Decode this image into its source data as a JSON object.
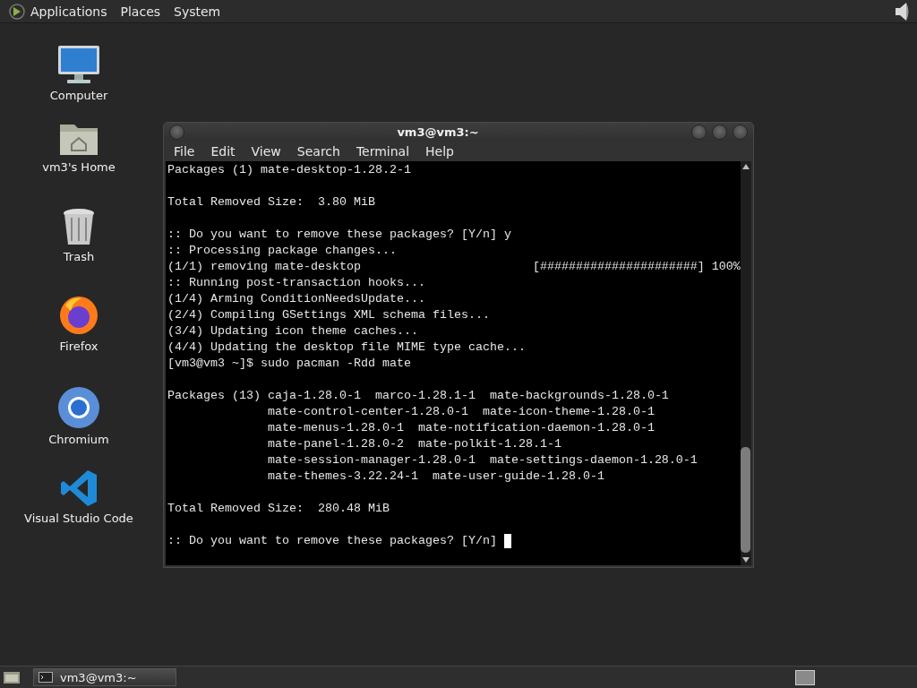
{
  "top_panel": {
    "menus": [
      "Applications",
      "Places",
      "System"
    ]
  },
  "desktop_icons": [
    {
      "label": "Computer",
      "kind": "computer"
    },
    {
      "label": "vm3's Home",
      "kind": "home"
    },
    {
      "label": "Trash",
      "kind": "trash"
    },
    {
      "label": "Firefox",
      "kind": "firefox"
    },
    {
      "label": "Chromium",
      "kind": "chromium"
    },
    {
      "label": "Visual Studio Code",
      "kind": "vscode"
    }
  ],
  "window": {
    "title": "vm3@vm3:~",
    "menu": [
      "File",
      "Edit",
      "View",
      "Search",
      "Terminal",
      "Help"
    ],
    "terminal_blocks": [
      {
        "lines": [
          {
            "text": "Packages (1) mate-desktop-1.28.2-1"
          }
        ]
      },
      {
        "lines": [
          {
            "text": "Total Removed Size:  3.80 MiB"
          }
        ]
      },
      {
        "lines": [
          {
            "text": ":: Do you want to remove these packages? [Y/n] y"
          },
          {
            "text": ":: Processing package changes..."
          },
          {
            "text": "(1/1) removing mate-desktop                        [######################] 100%"
          },
          {
            "text": ":: Running post-transaction hooks..."
          },
          {
            "text": "(1/4) Arming ConditionNeedsUpdate..."
          },
          {
            "text": "(2/4) Compiling GSettings XML schema files..."
          },
          {
            "text": "(3/4) Updating icon theme caches..."
          },
          {
            "text": "(4/4) Updating the desktop file MIME type cache..."
          },
          {
            "text": "[vm3@vm3 ~]$ sudo pacman -Rdd mate"
          }
        ]
      },
      {
        "lines": [
          {
            "text": "Packages (13) caja-1.28.0-1  marco-1.28.1-1  mate-backgrounds-1.28.0-1"
          },
          {
            "text": "              mate-control-center-1.28.0-1  mate-icon-theme-1.28.0-1"
          },
          {
            "text": "              mate-menus-1.28.0-1  mate-notification-daemon-1.28.0-1"
          },
          {
            "text": "              mate-panel-1.28.0-2  mate-polkit-1.28.1-1"
          },
          {
            "text": "              mate-session-manager-1.28.0-1  mate-settings-daemon-1.28.0-1"
          },
          {
            "text": "              mate-themes-3.22.24-1  mate-user-guide-1.28.0-1"
          }
        ]
      },
      {
        "lines": [
          {
            "text": "Total Removed Size:  280.48 MiB"
          }
        ]
      },
      {
        "lines": [
          {
            "text": ":: Do you want to remove these packages? [Y/n] ",
            "cursor": true
          }
        ]
      }
    ]
  },
  "taskbar": {
    "tasks": [
      {
        "label": "vm3@vm3:~",
        "selected": true
      }
    ]
  }
}
